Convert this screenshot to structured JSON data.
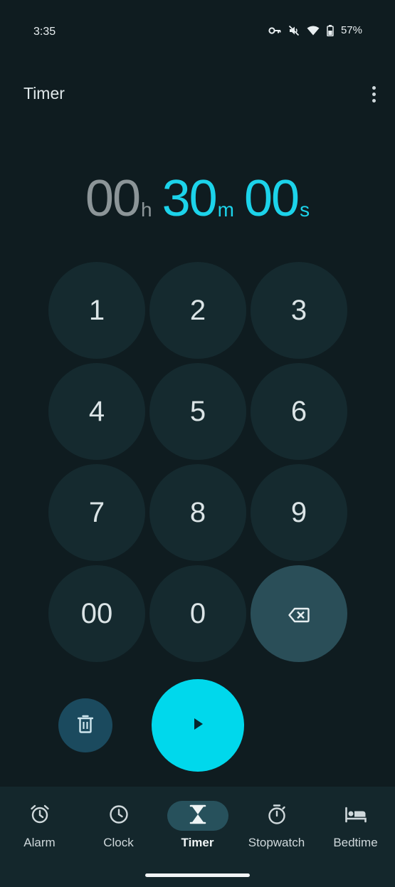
{
  "status_bar": {
    "time": "3:35",
    "battery": "57%"
  },
  "app_bar": {
    "title": "Timer"
  },
  "timer": {
    "hours": "00",
    "hours_unit": "h",
    "minutes": "30",
    "minutes_unit": "m",
    "seconds": "00",
    "seconds_unit": "s"
  },
  "keypad": {
    "keys": [
      "1",
      "2",
      "3",
      "4",
      "5",
      "6",
      "7",
      "8",
      "9",
      "00",
      "0"
    ]
  },
  "nav": {
    "items": [
      {
        "label": "Alarm",
        "icon": "alarm-icon"
      },
      {
        "label": "Clock",
        "icon": "clock-icon"
      },
      {
        "label": "Timer",
        "icon": "hourglass-icon"
      },
      {
        "label": "Stopwatch",
        "icon": "stopwatch-icon"
      },
      {
        "label": "Bedtime",
        "icon": "bed-icon"
      }
    ],
    "selected": "Timer"
  },
  "colors": {
    "accent": "#1cd3ea",
    "play": "#00d8ec",
    "background": "#0f1c20"
  }
}
